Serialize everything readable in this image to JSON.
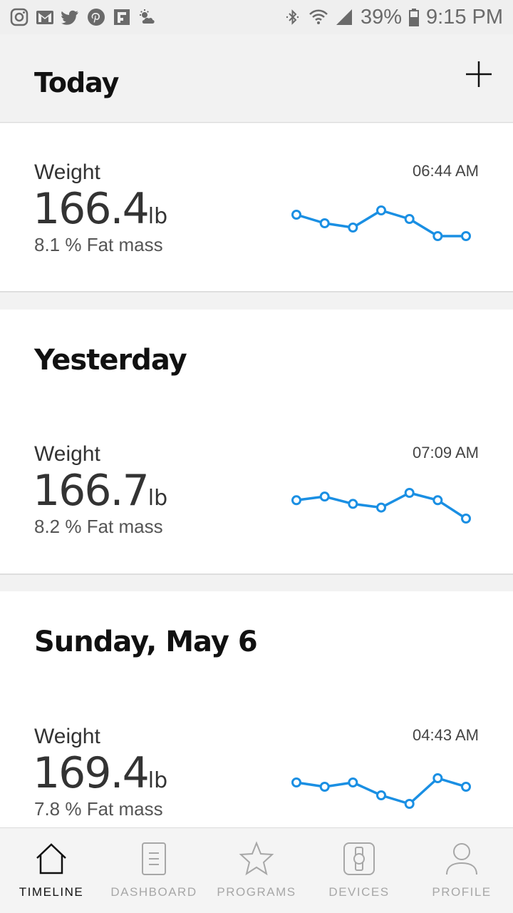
{
  "status_bar": {
    "left_icons": [
      "instagram-icon",
      "gmail-icon",
      "twitter-icon",
      "pinterest-icon",
      "flipboard-icon",
      "weather-icon"
    ],
    "battery": "39%",
    "time": "9:15 PM"
  },
  "header": {
    "title": "Today",
    "add_icon": "plus-icon"
  },
  "accent_color": "#1a8fe3",
  "entries": [
    {
      "metric_label": "Weight",
      "value": "166.4",
      "unit": "lb",
      "fat_mass": "8.1 % Fat mass",
      "time": "06:44 AM",
      "trend": [
        166.7,
        166.5,
        166.4,
        166.8,
        166.6,
        166.2,
        166.2
      ]
    },
    {
      "day": "Yesterday",
      "metric_label": "Weight",
      "value": "166.7",
      "unit": "lb",
      "fat_mass": "8.2 % Fat mass",
      "time": "07:09 AM",
      "trend": [
        166.9,
        167.0,
        166.8,
        166.7,
        167.1,
        166.9,
        166.4
      ]
    },
    {
      "day": "Sunday, May 6",
      "metric_label": "Weight",
      "value": "169.4",
      "unit": "lb",
      "fat_mass": "7.8 % Fat mass",
      "time": "04:43 AM",
      "trend": [
        169.6,
        169.5,
        169.6,
        169.3,
        169.1,
        169.7,
        169.5
      ]
    }
  ],
  "nav": [
    {
      "label": "TIMELINE",
      "icon": "home-icon",
      "active": true
    },
    {
      "label": "DASHBOARD",
      "icon": "dashboard-icon",
      "active": false
    },
    {
      "label": "PROGRAMS",
      "icon": "star-icon",
      "active": false
    },
    {
      "label": "DEVICES",
      "icon": "watch-icon",
      "active": false
    },
    {
      "label": "PROFILE",
      "icon": "profile-icon",
      "active": false
    }
  ]
}
